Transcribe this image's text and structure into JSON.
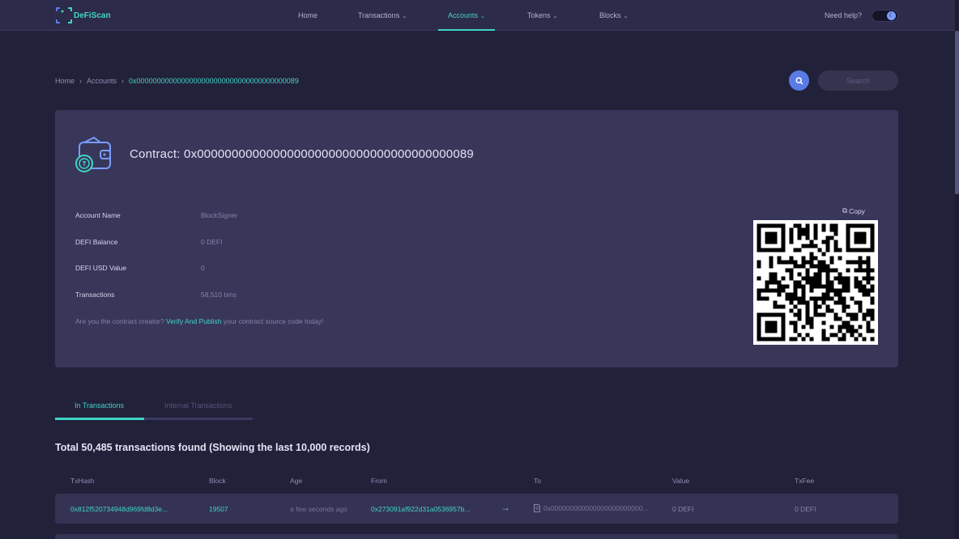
{
  "brand": {
    "name": "DeFiScan",
    "accent": "#3fd5c6"
  },
  "nav": {
    "items": [
      {
        "label": "Home"
      },
      {
        "label": "Transactions"
      },
      {
        "label": "Accounts"
      },
      {
        "label": "Tokens"
      },
      {
        "label": "Blocks"
      }
    ],
    "active": "Accounts",
    "help_label": "Need help?",
    "theme_toggle": "dark"
  },
  "breadcrumb": {
    "items": [
      "Home",
      "Accounts"
    ],
    "current": "0x0000000000000000000000000000000000000089"
  },
  "search": {
    "placeholder": "Search"
  },
  "contract": {
    "title": "Contract: 0x0000000000000000000000000000000000000089",
    "rows": [
      {
        "label": "Account Name",
        "value": "BlockSigner"
      },
      {
        "label": "DEFI Balance",
        "value": "0 DEFI"
      },
      {
        "label": "DEFI USD Value",
        "value": "0"
      },
      {
        "label": "Transactions",
        "value": "58,510 txns"
      }
    ],
    "creator_prefix": "Are you the contract creator?",
    "creator_link": "Verify And Publish",
    "creator_suffix": "your contract source code today!",
    "copy_label": "Copy"
  },
  "tabs": [
    {
      "label": "In Transactions",
      "active": true
    },
    {
      "label": "Internal Transactions",
      "active": false
    }
  ],
  "summary": "Total 50,485 transactions found (Showing the last 10,000 records)",
  "table": {
    "headers": [
      "TxHash",
      "Block",
      "Age",
      "From",
      "To",
      "Value",
      "TxFee"
    ],
    "rows": [
      {
        "txhash": "0x812f520734948d969fd8d3e...",
        "block": "19507",
        "age": "a few seconds ago",
        "from": "0x273091af922d31a0536957b...",
        "to": "0x000000000000000000000000...",
        "value": "0 DEFI",
        "txfee": "0 DEFI"
      }
    ]
  }
}
